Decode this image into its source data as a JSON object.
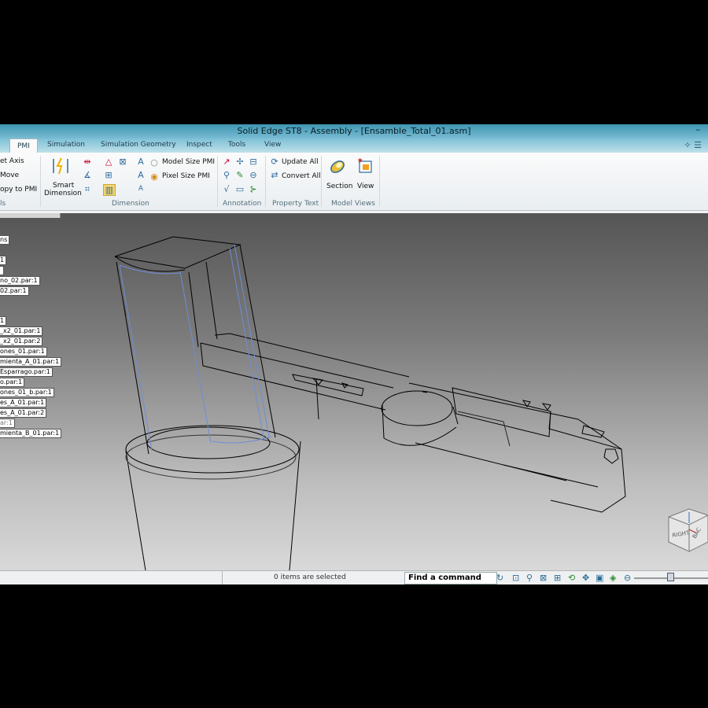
{
  "window": {
    "title": "Solid Edge ST8 - Assembly - [Ensamble_Total_01.asm]",
    "min_glyph": "–"
  },
  "tabs": [
    "PMI",
    "Simulation",
    "Simulation Geometry",
    "Inspect",
    "Tools",
    "View"
  ],
  "ribbon": {
    "left_group": {
      "items": [
        "et Axis",
        "Move",
        "opy to PMI"
      ],
      "label": "ls"
    },
    "dimension": {
      "smart_line1": "Smart",
      "smart_line2": "Dimension",
      "model_size": "Model Size PMI",
      "pixel_size": "Pixel Size PMI",
      "label": "Dimension"
    },
    "annotation": {
      "label": "Annotation"
    },
    "property_text": {
      "update_all": "Update All",
      "convert_all": "Convert All",
      "label": "Property Text"
    },
    "model_views": {
      "section": "Section",
      "view": "View",
      "label": "Model Views"
    }
  },
  "tree": {
    "items": [
      "ns",
      "1",
      "",
      "no_02.par:1",
      "02.par:1",
      "1",
      "_x2_01.par:1",
      "_x2_01.par:2",
      "ones_01.par:1",
      "mienta_A_01.par:1",
      "Esparrago.par:1",
      "o.par:1",
      "ones_01_b.par:1",
      "es_A_01.par:1",
      "es_A_01.par:2",
      "ar:1",
      "mienta_B_01.par:1"
    ]
  },
  "viewcube": {
    "right": "RIGHT",
    "back": "BAC"
  },
  "status": {
    "selection": "0 items are selected",
    "find_command": "Find a command"
  }
}
